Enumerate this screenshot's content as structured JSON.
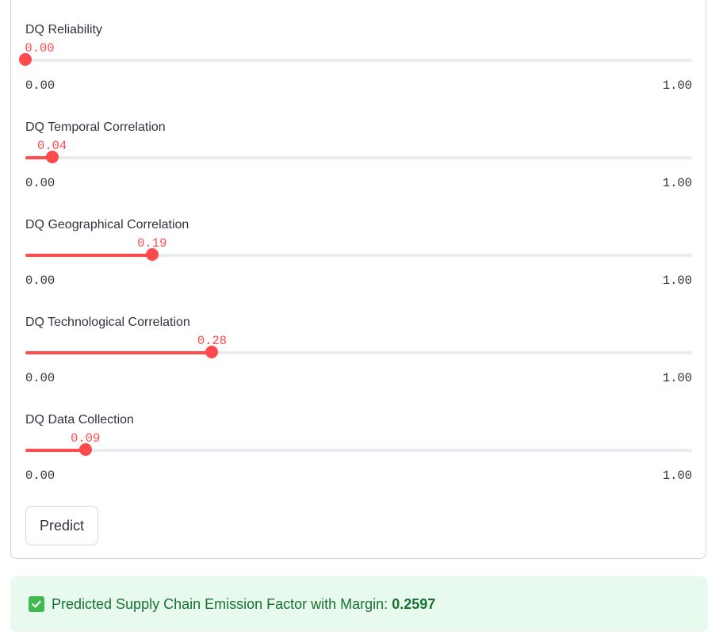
{
  "sliders": [
    {
      "label": "DQ Reliability",
      "value": 0.0,
      "value_text": "0.00",
      "min_text": "0.00",
      "max_text": "1.00"
    },
    {
      "label": "DQ Temporal Correlation",
      "value": 0.04,
      "value_text": "0.04",
      "min_text": "0.00",
      "max_text": "1.00"
    },
    {
      "label": "DQ Geographical Correlation",
      "value": 0.19,
      "value_text": "0.19",
      "min_text": "0.00",
      "max_text": "1.00"
    },
    {
      "label": "DQ Technological Correlation",
      "value": 0.28,
      "value_text": "0.28",
      "min_text": "0.00",
      "max_text": "1.00"
    },
    {
      "label": "DQ Data Collection",
      "value": 0.09,
      "value_text": "0.09",
      "min_text": "0.00",
      "max_text": "1.00"
    }
  ],
  "predict_button": {
    "label": "Predict"
  },
  "result": {
    "icon": "check-mark-button-icon",
    "text": "Predicted Supply Chain Emission Factor with Margin:",
    "value": "0.2597"
  },
  "colors": {
    "accent": "#ff4b4b",
    "track": "#eaebef",
    "success_bg": "#e8f9ee",
    "success_text": "#177233"
  }
}
